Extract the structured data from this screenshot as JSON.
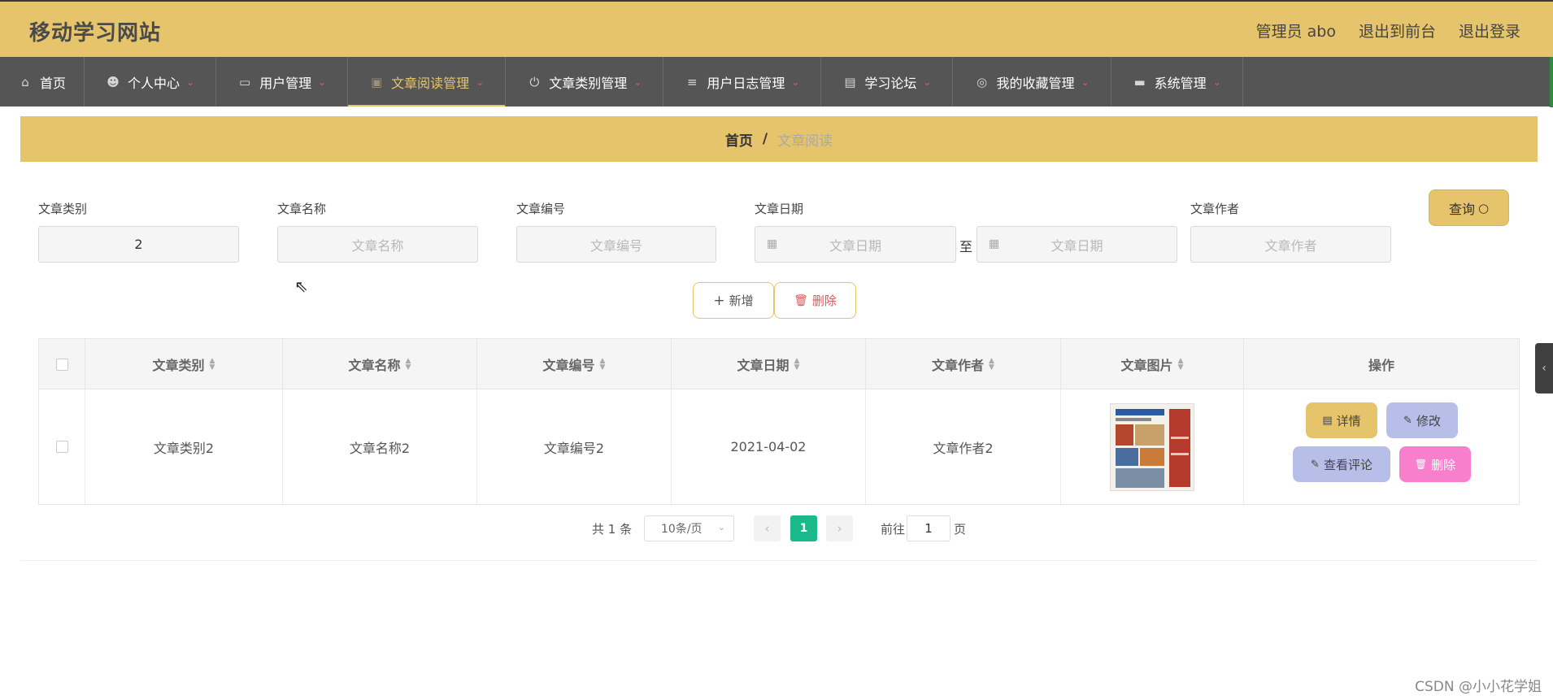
{
  "header": {
    "title": "移动学习网站",
    "admin": "管理员 abo",
    "to_front": "退出到前台",
    "logout": "退出登录"
  },
  "nav": {
    "items": [
      {
        "label": "首页",
        "icon": "home-icon",
        "glyph": "⌂",
        "caret": false
      },
      {
        "label": "个人中心",
        "icon": "user-icon",
        "glyph": "☻",
        "caret": true
      },
      {
        "label": "用户管理",
        "icon": "id-card-icon",
        "glyph": "▭",
        "caret": true
      },
      {
        "label": "文章阅读管理",
        "icon": "clipboard-icon",
        "glyph": "▣",
        "caret": true,
        "active": true
      },
      {
        "label": "文章类别管理",
        "icon": "power-icon",
        "glyph": "⏻",
        "caret": true
      },
      {
        "label": "用户日志管理",
        "icon": "list-icon",
        "glyph": "≡",
        "caret": true
      },
      {
        "label": "学习论坛",
        "icon": "chat-icon",
        "glyph": "▤",
        "caret": true
      },
      {
        "label": "我的收藏管理",
        "icon": "compass-icon",
        "glyph": "◎",
        "caret": true
      },
      {
        "label": "系统管理",
        "icon": "monitor-icon",
        "glyph": "▬",
        "caret": true
      }
    ],
    "caret_glyph": "⌄"
  },
  "breadcrumb": {
    "home": "首页",
    "sep": "/",
    "current": "文章阅读"
  },
  "search": {
    "category_label": "文章类别",
    "category_value": "2",
    "name_label": "文章名称",
    "name_placeholder": "文章名称",
    "number_label": "文章编号",
    "number_placeholder": "文章编号",
    "date_label": "文章日期",
    "date_start_placeholder": "文章日期",
    "date_to": "至",
    "date_end_placeholder": "文章日期",
    "author_label": "文章作者",
    "author_placeholder": "文章作者",
    "query_button": "查询"
  },
  "actions": {
    "add": "新增",
    "delete": "删除"
  },
  "table": {
    "columns": [
      "文章类别",
      "文章名称",
      "文章编号",
      "文章日期",
      "文章作者",
      "文章图片",
      "操作"
    ],
    "rows": [
      {
        "category": "文章类别2",
        "name": "文章名称2",
        "number": "文章编号2",
        "date": "2021-04-02",
        "author": "文章作者2",
        "buttons": {
          "detail": "详情",
          "edit": "修改",
          "comments": "查看评论",
          "delete": "删除"
        }
      }
    ]
  },
  "pagination": {
    "total": "共 1 条",
    "page_size": "10条/页",
    "current_page": "1",
    "goto_label": "前往",
    "goto_value": "1",
    "page_suffix": "页"
  },
  "colors": {
    "primary": "#e6c46c",
    "nav_bg": "#555555",
    "page_active": "#19b98c",
    "edit_btn": "#b7bfe9",
    "delete_btn": "#f77fcb"
  },
  "watermark": "CSDN @小小花学姐"
}
